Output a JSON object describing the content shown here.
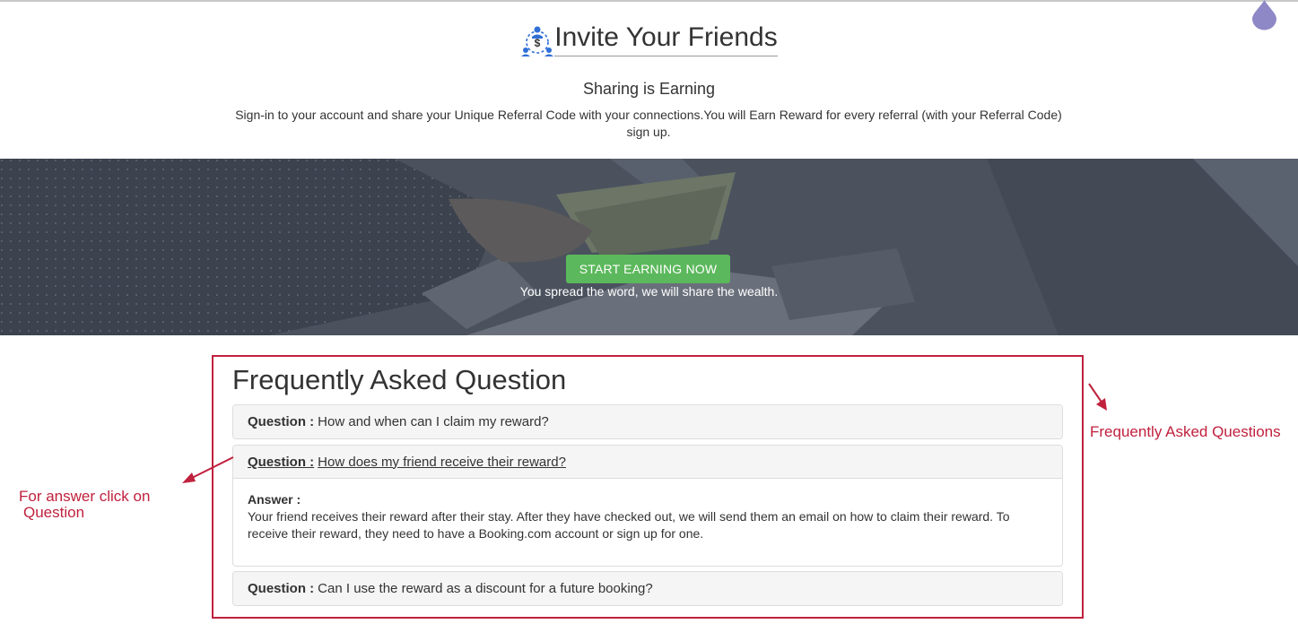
{
  "header": {
    "title": "Invite Your Friends",
    "subtitle": "Sharing is Earning",
    "description": "Sign-in to your account and share your Unique Referral Code with your connections.You will Earn Reward for every referral (with your Referral Code) sign up."
  },
  "hero": {
    "cta_label": "START EARNING NOW",
    "tagline": "You spread the word, we will share the wealth."
  },
  "faq": {
    "title": "Frequently Asked Question",
    "items": [
      {
        "prefix": "Question :",
        "question": "How and when can I claim my reward?",
        "expanded": false
      },
      {
        "prefix": "Question :",
        "question": "How does my friend receive their reward?",
        "expanded": true,
        "answer_label": "Answer :",
        "answer": "Your friend receives their reward after their stay. After they have checked out, we will send them an email on how to claim their reward. To receive their reward, they need to have a Booking.com account or sign up for one."
      },
      {
        "prefix": "Question :",
        "question": "Can I use the reward as a discount for a future booking?",
        "expanded": false
      }
    ]
  },
  "annotations": {
    "left_line1": "For answer click on",
    "left_line2": "Question",
    "right": "Frequently Asked Questions"
  },
  "colors": {
    "annotation": "#c0213d",
    "cta": "#5cb85c",
    "hero_overlay": "#4a5260"
  }
}
